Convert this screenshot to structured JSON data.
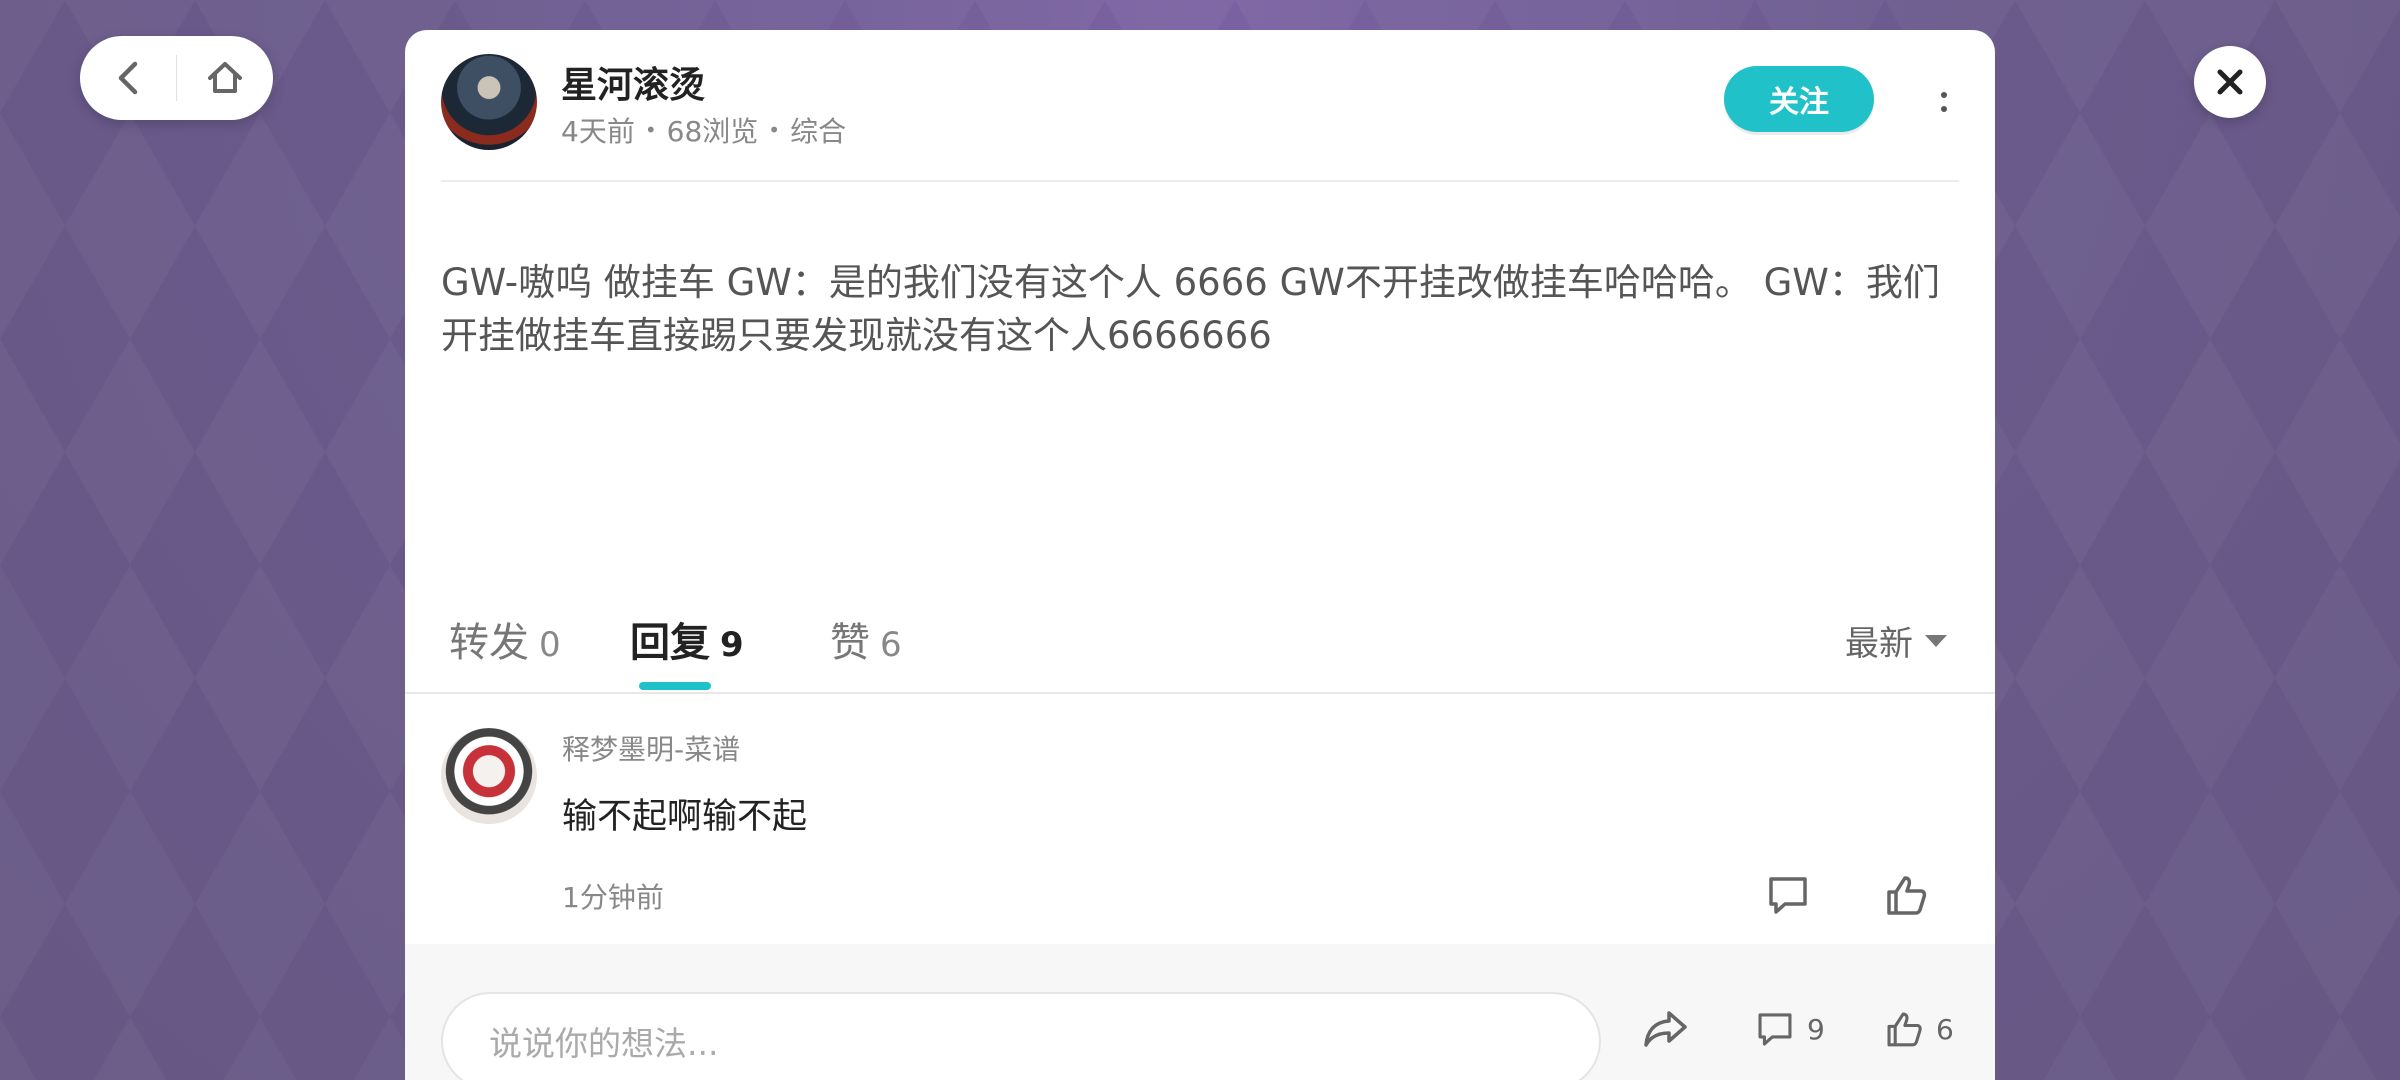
{
  "nav": {
    "back_icon": "chevron-left-icon",
    "home_icon": "home-icon"
  },
  "post": {
    "author": "星河滚烫",
    "time": "4天前",
    "views": "68浏览",
    "category": "综合",
    "follow_label": "关注",
    "content": "GW-嗷呜 做挂车 GW：是的我们没有这个人 6666 GW不开挂改做挂车哈哈哈。 GW：我们开挂做挂车直接踢只要发现就没有这个人6666666"
  },
  "tabs": [
    {
      "label": "转发",
      "count": "0",
      "active": false
    },
    {
      "label": "回复",
      "count": "9",
      "active": true
    },
    {
      "label": "赞",
      "count": "6",
      "active": false
    }
  ],
  "sort_label": "最新",
  "comments": [
    {
      "user": "释梦墨明-菜谱",
      "text": "输不起啊输不起",
      "time": "1分钟前"
    }
  ],
  "bottom_bar": {
    "placeholder": "说说你的想法...",
    "comment_count": "9",
    "like_count": "6"
  },
  "colors": {
    "accent": "#20c1c9",
    "background": "#6a5a8c"
  }
}
